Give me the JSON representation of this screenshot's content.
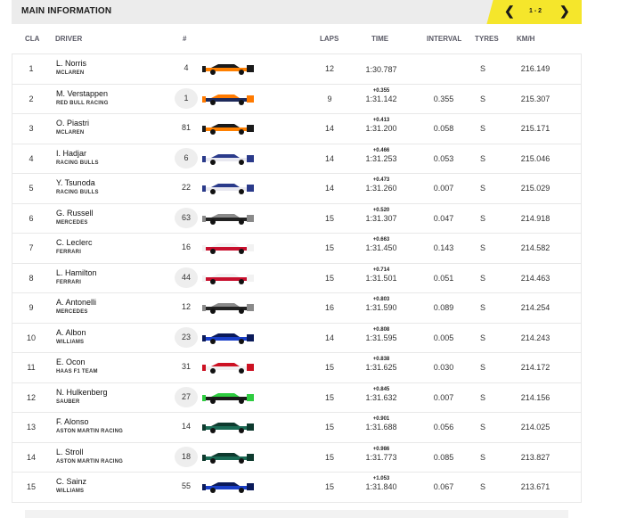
{
  "header": {
    "title": "MAIN INFORMATION",
    "pager": {
      "label": "1 - 2",
      "prev_icon": "chevron-left-icon",
      "next_icon": "chevron-right-icon"
    }
  },
  "columns": [
    "CLA",
    "DRIVER",
    "#",
    "LAPS",
    "TIME",
    "INTERVAL",
    "TYRES",
    "KM/H"
  ],
  "colors": {
    "accent": "#f5e62b"
  },
  "rows": [
    {
      "pos": "1",
      "name": "L. Norris",
      "team": "MCLAREN",
      "num": "4",
      "badge": false,
      "laps": "12",
      "gap": "",
      "time": "1:30.787",
      "interval": "",
      "tyre": "S",
      "kmh": "216.149",
      "car": [
        "#ff8000",
        "#1a1a1a"
      ]
    },
    {
      "pos": "2",
      "name": "M. Verstappen",
      "team": "RED BULL RACING",
      "num": "1",
      "badge": true,
      "laps": "9",
      "gap": "+0.355",
      "time": "1:31.142",
      "interval": "0.355",
      "tyre": "S",
      "kmh": "215.307",
      "car": [
        "#1e2a5a",
        "#ff7a00"
      ]
    },
    {
      "pos": "3",
      "name": "O. Piastri",
      "team": "MCLAREN",
      "num": "81",
      "badge": false,
      "laps": "14",
      "gap": "+0.413",
      "time": "1:31.200",
      "interval": "0.058",
      "tyre": "S",
      "kmh": "215.171",
      "car": [
        "#ff8000",
        "#1a1a1a"
      ]
    },
    {
      "pos": "4",
      "name": "I. Hadjar",
      "team": "RACING BULLS",
      "num": "6",
      "badge": true,
      "laps": "14",
      "gap": "+0.466",
      "time": "1:31.253",
      "interval": "0.053",
      "tyre": "S",
      "kmh": "215.046",
      "car": [
        "#e8e8f0",
        "#2a3a8a"
      ]
    },
    {
      "pos": "5",
      "name": "Y. Tsunoda",
      "team": "RACING BULLS",
      "num": "22",
      "badge": false,
      "laps": "14",
      "gap": "+0.473",
      "time": "1:31.260",
      "interval": "0.007",
      "tyre": "S",
      "kmh": "215.029",
      "car": [
        "#e8e8f0",
        "#2a3a8a"
      ]
    },
    {
      "pos": "6",
      "name": "G. Russell",
      "team": "MERCEDES",
      "num": "63",
      "badge": true,
      "laps": "15",
      "gap": "+0.520",
      "time": "1:31.307",
      "interval": "0.047",
      "tyre": "S",
      "kmh": "214.918",
      "car": [
        "#222222",
        "#8a8a8a"
      ]
    },
    {
      "pos": "7",
      "name": "C. Leclerc",
      "team": "FERRARI",
      "num": "16",
      "badge": false,
      "laps": "15",
      "gap": "+0.663",
      "time": "1:31.450",
      "interval": "0.143",
      "tyre": "S",
      "kmh": "214.582",
      "car": [
        "#c8102e",
        "#f2f2f2"
      ]
    },
    {
      "pos": "8",
      "name": "L. Hamilton",
      "team": "FERRARI",
      "num": "44",
      "badge": true,
      "laps": "15",
      "gap": "+0.714",
      "time": "1:31.501",
      "interval": "0.051",
      "tyre": "S",
      "kmh": "214.463",
      "car": [
        "#c8102e",
        "#f2f2f2"
      ]
    },
    {
      "pos": "9",
      "name": "A. Antonelli",
      "team": "MERCEDES",
      "num": "12",
      "badge": false,
      "laps": "16",
      "gap": "+0.803",
      "time": "1:31.590",
      "interval": "0.089",
      "tyre": "S",
      "kmh": "214.254",
      "car": [
        "#222222",
        "#8a8a8a"
      ]
    },
    {
      "pos": "10",
      "name": "A. Albon",
      "team": "WILLIAMS",
      "num": "23",
      "badge": true,
      "laps": "14",
      "gap": "+0.808",
      "time": "1:31.595",
      "interval": "0.005",
      "tyre": "S",
      "kmh": "214.243",
      "car": [
        "#1a3fc8",
        "#0a1a5a"
      ]
    },
    {
      "pos": "11",
      "name": "E. Ocon",
      "team": "HAAS F1 TEAM",
      "num": "31",
      "badge": false,
      "laps": "15",
      "gap": "+0.838",
      "time": "1:31.625",
      "interval": "0.030",
      "tyre": "S",
      "kmh": "214.172",
      "car": [
        "#f0f0f0",
        "#cc1122"
      ]
    },
    {
      "pos": "12",
      "name": "N. Hulkenberg",
      "team": "SAUBER",
      "num": "27",
      "badge": true,
      "laps": "15",
      "gap": "+0.845",
      "time": "1:31.632",
      "interval": "0.007",
      "tyre": "S",
      "kmh": "214.156",
      "car": [
        "#1a1a1a",
        "#2ecc40"
      ]
    },
    {
      "pos": "13",
      "name": "F. Alonso",
      "team": "ASTON MARTIN RACING",
      "num": "14",
      "badge": false,
      "laps": "15",
      "gap": "+0.901",
      "time": "1:31.688",
      "interval": "0.056",
      "tyre": "S",
      "kmh": "214.025",
      "car": [
        "#1b6b55",
        "#0e3a2e"
      ]
    },
    {
      "pos": "14",
      "name": "L. Stroll",
      "team": "ASTON MARTIN RACING",
      "num": "18",
      "badge": true,
      "laps": "15",
      "gap": "+0.986",
      "time": "1:31.773",
      "interval": "0.085",
      "tyre": "S",
      "kmh": "213.827",
      "car": [
        "#1b6b55",
        "#0e3a2e"
      ]
    },
    {
      "pos": "15",
      "name": "C. Sainz",
      "team": "WILLIAMS",
      "num": "55",
      "badge": false,
      "laps": "15",
      "gap": "+1.053",
      "time": "1:31.840",
      "interval": "0.067",
      "tyre": "S",
      "kmh": "213.671",
      "car": [
        "#1a3fc8",
        "#0a1a5a"
      ]
    }
  ]
}
